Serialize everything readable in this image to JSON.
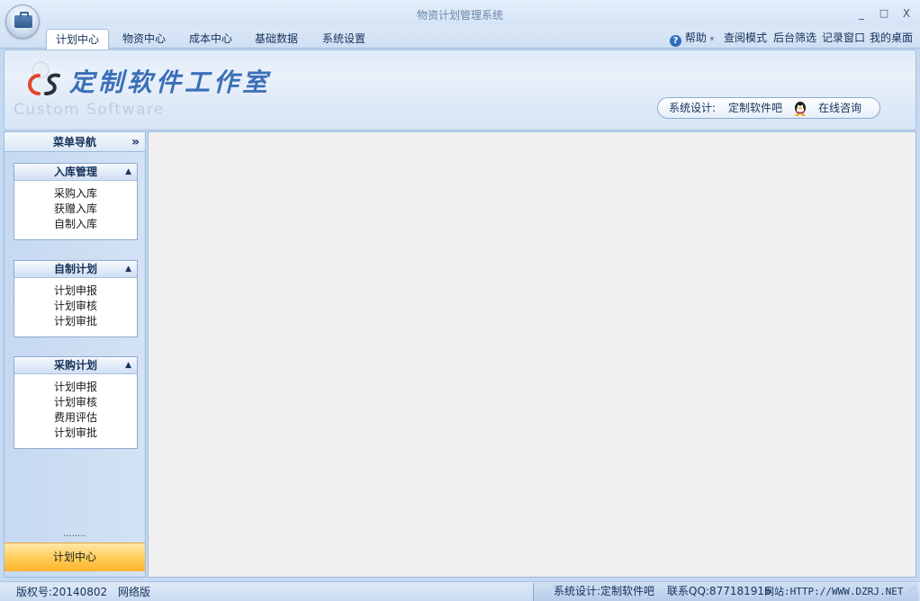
{
  "window": {
    "title": "物资计划管理系统",
    "controls": {
      "minimize": "_",
      "maximize": "□",
      "close": "X"
    }
  },
  "menu": {
    "tabs": [
      {
        "label": "计划中心",
        "active": true
      },
      {
        "label": "物资中心"
      },
      {
        "label": "成本中心"
      },
      {
        "label": "基础数据"
      },
      {
        "label": "系统设置"
      }
    ],
    "right": {
      "help": "帮助",
      "help_caret": "▾",
      "view_mode": "查阅模式",
      "bg_filter": "后台筛选",
      "record_window": "记录窗口",
      "my_desktop": "我的桌面"
    }
  },
  "banner": {
    "logo_mark": "CS",
    "logo_title": "定制软件工作室",
    "logo_sub": "Custom Software",
    "contact": {
      "label": "系统设计:",
      "name": "定制软件吧",
      "consult": "在线咨询"
    }
  },
  "nav": {
    "title": "菜单导航",
    "collapse": "»",
    "groups": [
      {
        "title": "入库管理",
        "items": [
          "采购入库",
          "获赠入库",
          "自制入库"
        ]
      },
      {
        "title": "自制计划",
        "items": [
          "计划申报",
          "计划审核",
          "计划审批"
        ]
      },
      {
        "title": "采购计划",
        "items": [
          "计划申报",
          "计划审核",
          "费用评估",
          "计划审批"
        ]
      }
    ],
    "grip": "........",
    "active_module": "计划中心"
  },
  "status": {
    "version": "版权号:20140802",
    "edition": "网络版",
    "designer": "系统设计:定制软件吧",
    "qq": "联系QQ:877181916",
    "site": "网站:HTTP://WWW.DZRJ.NET"
  },
  "colors": {
    "accent": "#3b6fb8",
    "active_module": "#ffc950",
    "frame": "#c5d9f1"
  }
}
